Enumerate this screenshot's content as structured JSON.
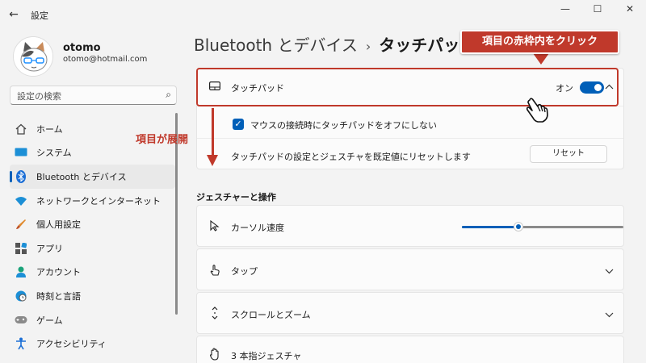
{
  "window": {
    "title": "設定",
    "back": "←",
    "minimize": "—",
    "maximize": "☐",
    "close": "✕"
  },
  "user": {
    "name": "otomo",
    "email": "otomo@hotmail.com"
  },
  "search": {
    "placeholder": "設定の検索",
    "icon": "⌕"
  },
  "nav": {
    "items": [
      {
        "label": "ホーム",
        "icon": "home-icon"
      },
      {
        "label": "システム",
        "icon": "system-icon"
      },
      {
        "label": "Bluetooth とデバイス",
        "icon": "bluetooth-icon",
        "active": true
      },
      {
        "label": "ネットワークとインターネット",
        "icon": "wifi-icon"
      },
      {
        "label": "個人用設定",
        "icon": "brush-icon"
      },
      {
        "label": "アプリ",
        "icon": "apps-icon"
      },
      {
        "label": "アカウント",
        "icon": "account-icon"
      },
      {
        "label": "時刻と言語",
        "icon": "globe-clock-icon"
      },
      {
        "label": "ゲーム",
        "icon": "gamepad-icon"
      },
      {
        "label": "アクセシビリティ",
        "icon": "accessibility-icon"
      }
    ]
  },
  "breadcrumb": {
    "parent": "Bluetooth とデバイス",
    "separator": "›",
    "current": "タッチパッド"
  },
  "touchpad": {
    "label": "タッチパッド",
    "toggle_text": "オン",
    "toggle_on": true,
    "keep_on_label": "マウスの接続時にタッチパッドをオフにしない",
    "keep_on_checked": true,
    "reset_label": "タッチパッドの設定とジェスチャを既定値にリセットします",
    "reset_button": "リセット"
  },
  "gestures": {
    "section_title": "ジェスチャーと操作",
    "cursor_speed_label": "カーソル速度",
    "cursor_speed_fraction": 0.35,
    "tap_label": "タップ",
    "scroll_label": "スクロールとズーム",
    "three_finger_label": "3 本指ジェスチャ"
  },
  "annotations": {
    "callout": "項目の赤枠内をクリック",
    "expand": "項目が展開"
  },
  "colors": {
    "accent": "#005fb8",
    "annotation": "#c0392b"
  }
}
